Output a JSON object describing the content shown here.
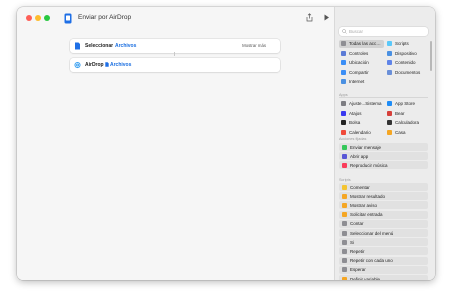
{
  "window": {
    "title": "Enviar por AirDrop"
  },
  "editor": {
    "actions": [
      {
        "name": "Seleccionar",
        "param": "Archivos",
        "more": "Mostrar más"
      },
      {
        "name": "AirDrop",
        "param": "Archivos",
        "param_icon": "file-badge-icon"
      }
    ]
  },
  "sidebar": {
    "search_placeholder": "Buscar",
    "categories": [
      {
        "label": "Todas las acc…",
        "icon": "list-icon",
        "color": "#8e8e93",
        "selected": true
      },
      {
        "label": "Scripts",
        "icon": "scripts-icon",
        "color": "#5ac8fa"
      },
      {
        "label": "Controles",
        "icon": "controls-icon",
        "color": "#5b7bd6"
      },
      {
        "label": "Dispositivo",
        "icon": "device-icon",
        "color": "#4a90e2"
      },
      {
        "label": "Ubicación",
        "icon": "location-icon",
        "color": "#3a8ef6"
      },
      {
        "label": "Contenido",
        "icon": "content-icon",
        "color": "#5f84e8"
      },
      {
        "label": "Compartir",
        "icon": "share-icon",
        "color": "#3a8ef6"
      },
      {
        "label": "Documentos",
        "icon": "documents-icon",
        "color": "#6a8fd8"
      },
      {
        "label": "Internet",
        "icon": "internet-icon",
        "color": "#4a90e2"
      }
    ],
    "apps_heading": "Apps",
    "apps": [
      {
        "label": "Ajuste...Sistema",
        "icon": "settings-icon",
        "color": "#7d7d82"
      },
      {
        "label": "App Store",
        "icon": "appstore-icon",
        "color": "#1e8cf6"
      },
      {
        "label": "Atajos",
        "icon": "shortcuts-icon",
        "color": "#3a3af0"
      },
      {
        "label": "Bear",
        "icon": "bear-icon",
        "color": "#d6403a"
      },
      {
        "label": "Bolsa",
        "icon": "stocks-icon",
        "color": "#222222"
      },
      {
        "label": "Calculadora",
        "icon": "calculator-icon",
        "color": "#333333"
      },
      {
        "label": "Calendario",
        "icon": "calendar-icon",
        "color": "#f04a3a"
      },
      {
        "label": "Casa",
        "icon": "home-icon",
        "color": "#f5a623"
      }
    ],
    "suggestions_heading": "Acciones fijadas",
    "suggestions": [
      {
        "label": "Enviar mensaje",
        "icon": "messages-icon",
        "color": "#34c759"
      },
      {
        "label": "Abrir app",
        "icon": "open-app-icon",
        "color": "#5856d6"
      },
      {
        "label": "Reproducir música",
        "icon": "music-icon",
        "color": "#fa3c5a"
      }
    ],
    "scripts_heading": "Scripts",
    "scripts": [
      {
        "label": "Comentar",
        "icon": "comment-icon",
        "color": "#f4c430"
      },
      {
        "label": "Mostrar resultado",
        "icon": "show-result-icon",
        "color": "#f5a623"
      },
      {
        "label": "Mostrar aviso",
        "icon": "alert-icon",
        "color": "#f5a623"
      },
      {
        "label": "Solicitar entrada",
        "icon": "input-icon",
        "color": "#f5a623"
      },
      {
        "label": "Contar",
        "icon": "count-icon",
        "color": "#8e8e93"
      },
      {
        "label": "Seleccionar del menú",
        "icon": "menu-icon",
        "color": "#8e8e93"
      },
      {
        "label": "Si",
        "icon": "if-icon",
        "color": "#8e8e93"
      },
      {
        "label": "Repetir",
        "icon": "repeat-icon",
        "color": "#8e8e93"
      },
      {
        "label": "Repetir con cada uno",
        "icon": "repeat-each-icon",
        "color": "#8e8e93"
      },
      {
        "label": "Esperar",
        "icon": "wait-icon",
        "color": "#8e8e93"
      },
      {
        "label": "Definir variable",
        "icon": "variable-icon",
        "color": "#f5a623"
      }
    ]
  }
}
